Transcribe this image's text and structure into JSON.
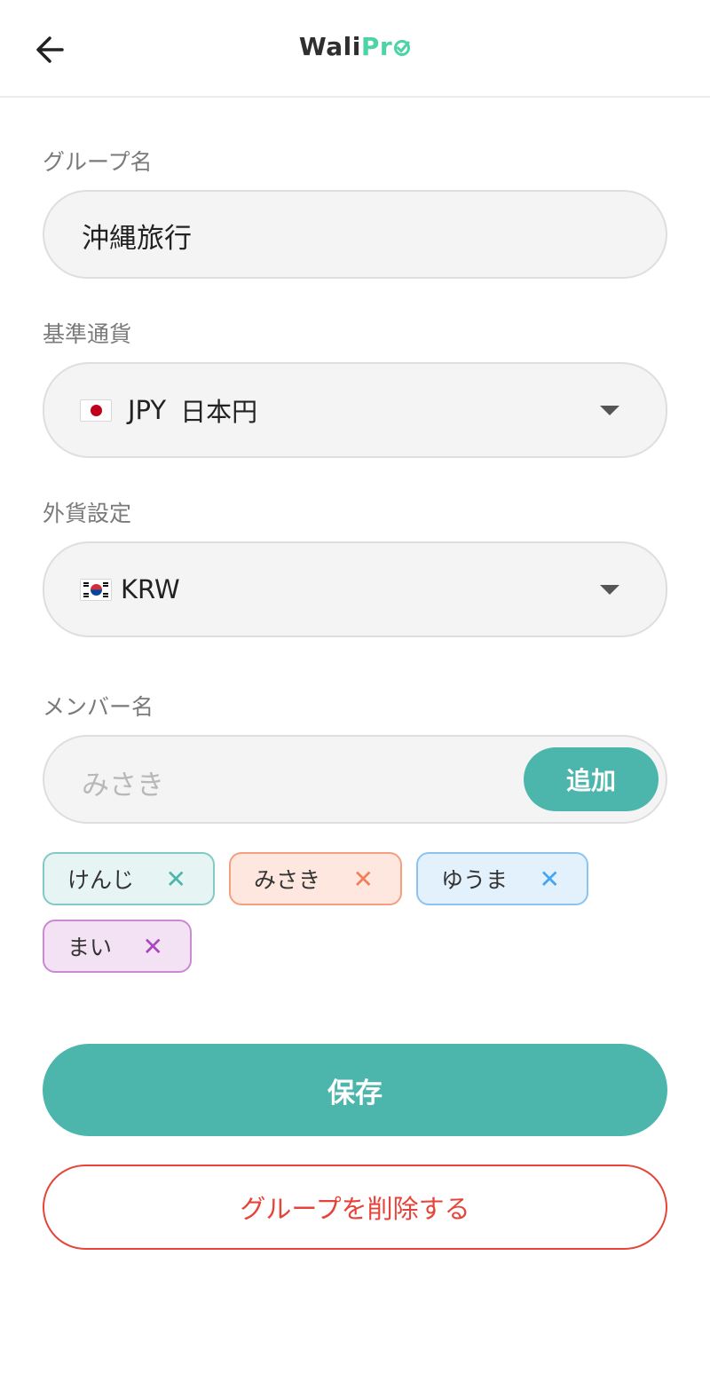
{
  "header": {
    "back_icon": "arrow-left-icon",
    "logo_part1": "Wali",
    "logo_part2": "Pr",
    "logo_check_icon": "check-circle-icon",
    "logo_color_dark": "#2f2f2f",
    "logo_color_accent": "#4cd3a7"
  },
  "form": {
    "group_name_label": "グループ名",
    "group_name_value": "沖縄旅行",
    "base_currency_label": "基準通貨",
    "base_currency_code": "JPY",
    "base_currency_name": "日本円",
    "base_currency_flag": "jp-flag-icon",
    "foreign_currency_label": "外貨設定",
    "foreign_currency_code": "KRW",
    "foreign_currency_flag": "kr-flag-icon",
    "member_name_label": "メンバー名",
    "member_name_placeholder": "みさき",
    "add_button_label": "追加"
  },
  "members": [
    {
      "name": "けんじ",
      "remove_label": "✕",
      "color": "#4db6ac"
    },
    {
      "name": "みさき",
      "remove_label": "✕",
      "color": "#f07f5a"
    },
    {
      "name": "ゆうま",
      "remove_label": "✕",
      "color": "#42a5f5"
    },
    {
      "name": "まい",
      "remove_label": "✕",
      "color": "#ab47bc"
    }
  ],
  "actions": {
    "save_label": "保存",
    "delete_label": "グループを削除する"
  },
  "colors": {
    "primary": "#4db6ac",
    "danger": "#e6443a"
  }
}
